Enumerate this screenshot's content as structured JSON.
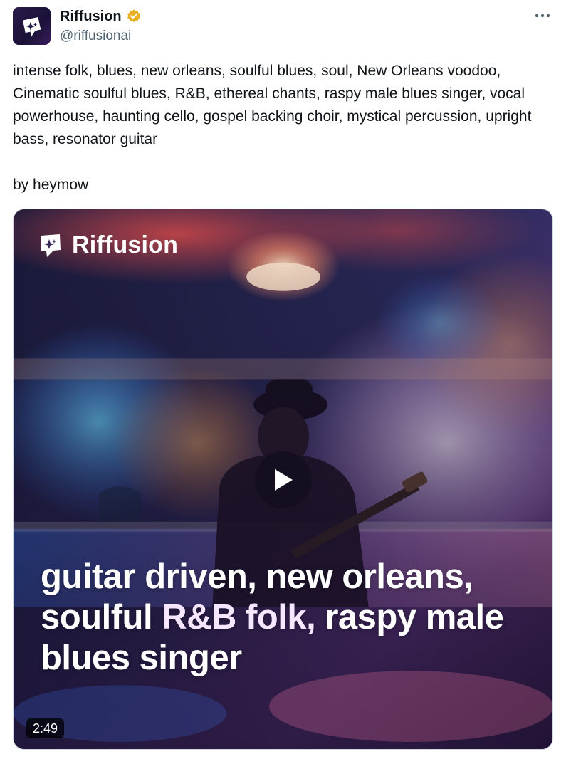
{
  "author": {
    "display_name": "Riffusion",
    "handle": "@riffusionai",
    "verified": true,
    "verified_badge_color": "#e8b125",
    "avatar_icon": "riffusion-logo-icon"
  },
  "menu": {
    "more_icon": "more-horizontal-icon"
  },
  "tweet": {
    "text": "intense folk, blues, new orleans, soulful blues, soul, New Orleans voodoo, Cinematic soulful blues, R&B, ethereal chants, raspy male blues singer, vocal powerhouse, haunting cello, gospel backing choir, mystical percussion, upright bass, resonator guitar\n\nby heymow"
  },
  "media": {
    "brand_name": "Riffusion",
    "brand_icon": "riffusion-logo-icon",
    "play_icon": "play-icon",
    "caption_part1": "guitar driven, new orleans, soulful ",
    "caption_part2": "R&B folk,",
    "caption_part3": " raspy male blues singer",
    "duration": "2:49"
  }
}
